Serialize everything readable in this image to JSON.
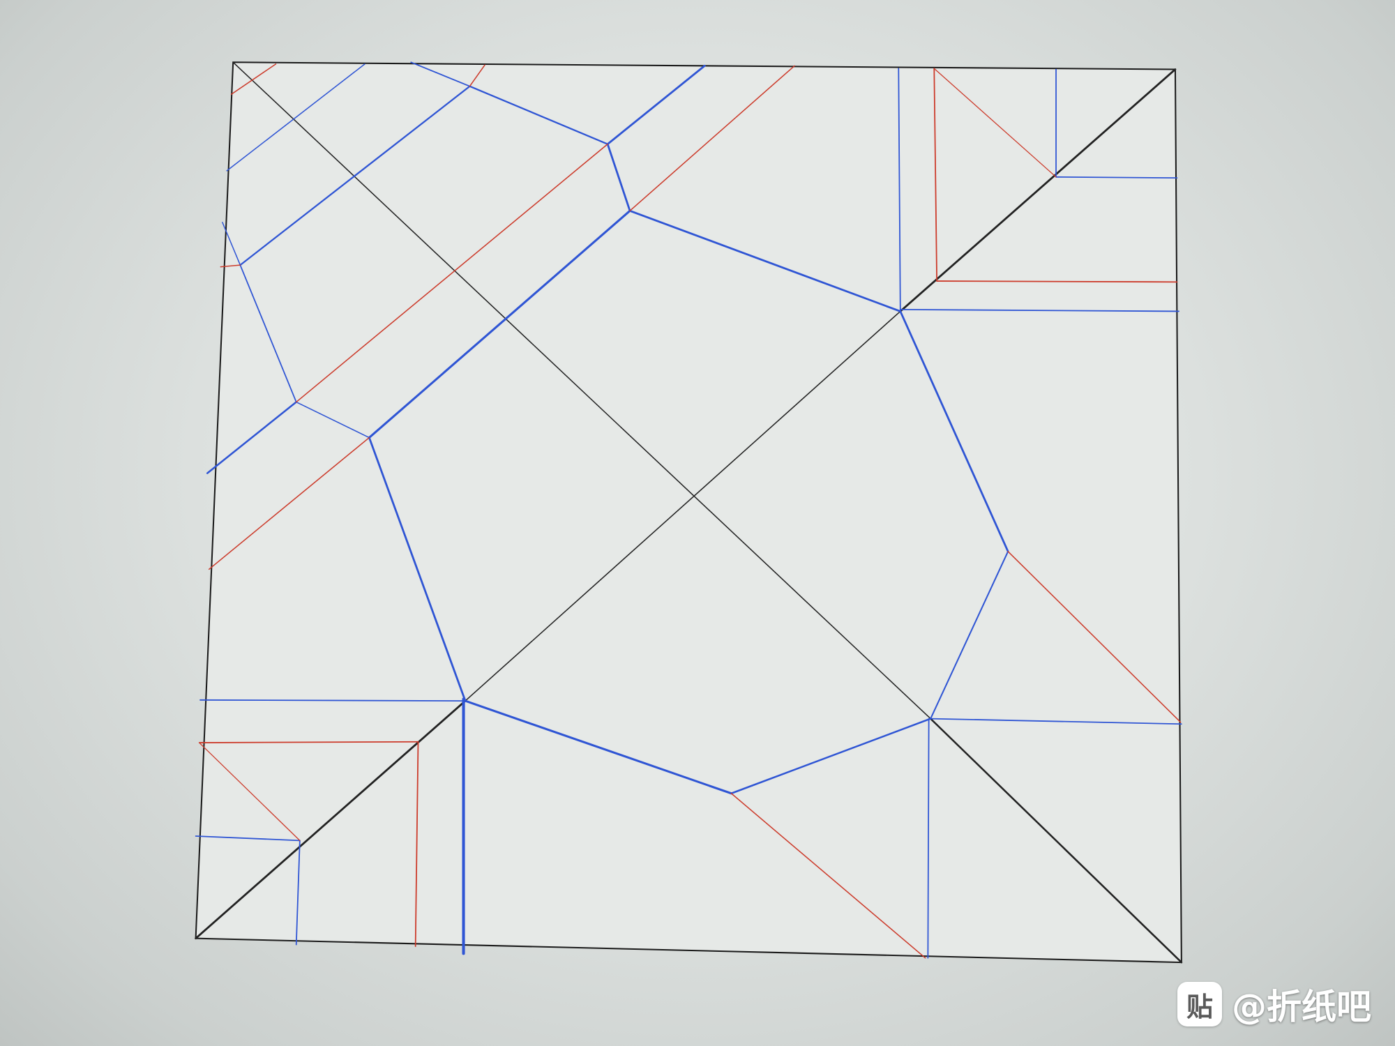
{
  "diagram": {
    "line_colors": {
      "border": "#1a1a1a",
      "auxiliary": "#222222",
      "valley": "#2f55d4",
      "mountain": "#cc3a2a"
    },
    "background": "#e6e9e7"
  },
  "watermark": {
    "badge_text": "贴",
    "text": "@折纸吧"
  }
}
